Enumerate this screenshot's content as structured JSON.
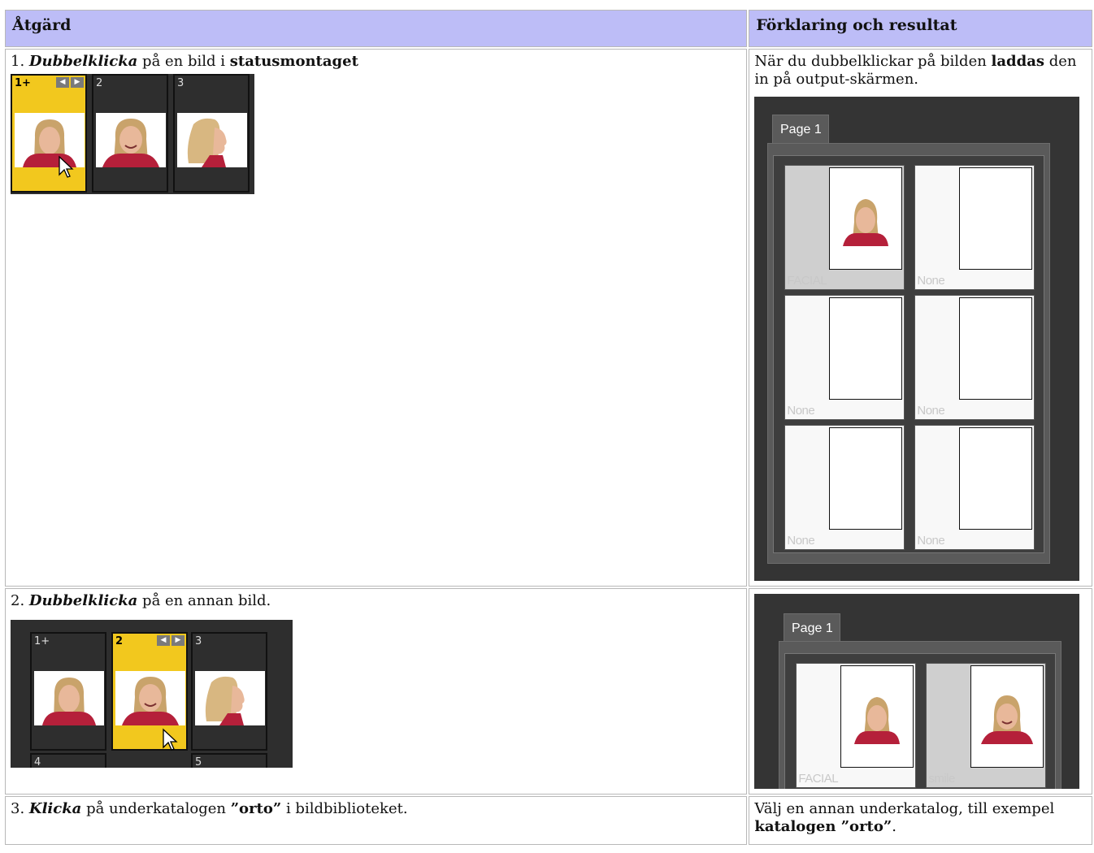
{
  "headers": {
    "action": "Åtgärd",
    "explanation": "Förklaring och resultat"
  },
  "row1": {
    "num": "1.",
    "verb": "Dubbelklicka",
    "text_mid": " på en bild i ",
    "bold_end": "statusmontaget",
    "thumbs": [
      "1+",
      "2",
      "3"
    ],
    "expl_before": "När du dubbelklickar på bilden ",
    "expl_bold": "laddas",
    "expl_after": " den in på output-skärmen.",
    "tab": "Page 1",
    "slots": [
      "FACIAL",
      "None",
      "None",
      "None",
      "None",
      "None"
    ]
  },
  "row2": {
    "num": "2.",
    "verb": "Dubbelklicka",
    "text_after": " på en annan bild.",
    "thumbs": [
      "1+",
      "2",
      "3",
      "4",
      "5"
    ],
    "tab": "Page 1",
    "slots": [
      "FACIAL",
      "smile"
    ]
  },
  "row3": {
    "num": "3.",
    "verb": "Klicka",
    "text_mid": " på underkatalogen ",
    "bold_q": "”orto”",
    "text_after": " i bildbiblioteket.",
    "expl_before": "Välj en annan underkatalog, till exempel ",
    "expl_bold1": "katalogen ”orto”",
    "expl_after": "."
  },
  "colors": {
    "header_bg": "#bdbdf7",
    "selected_thumb": "#f2c81e",
    "dark_bg": "#2e2e2e"
  }
}
